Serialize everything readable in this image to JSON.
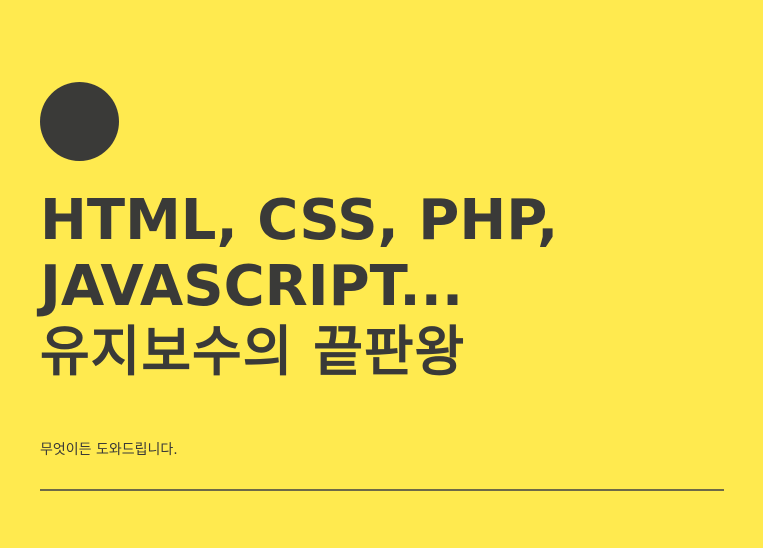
{
  "banner": {
    "headline_line1": "HTML, CSS, PHP,",
    "headline_line2": "JAVASCRIPT...",
    "headline_line3": "유지보수의 끝판왕",
    "subtitle": "무엇이든 도와드립니다."
  },
  "colors": {
    "background": "#FFEA4F",
    "text": "#3A3A38",
    "divider": "#6E6A48"
  }
}
